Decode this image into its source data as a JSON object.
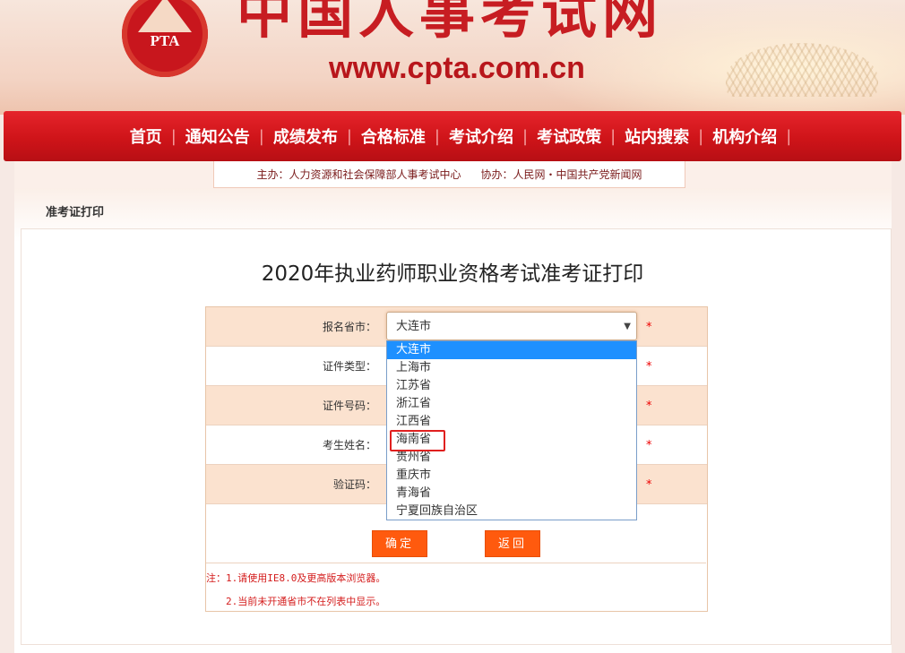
{
  "header": {
    "logo_text": "PTA",
    "site_title": "中国人事考试网",
    "site_url": "www.cpta.com.cn"
  },
  "nav": [
    {
      "label": "首页"
    },
    {
      "label": "通知公告"
    },
    {
      "label": "成绩发布"
    },
    {
      "label": "合格标准"
    },
    {
      "label": "考试介绍"
    },
    {
      "label": "考试政策"
    },
    {
      "label": "站内搜索"
    },
    {
      "label": "机构介绍"
    }
  ],
  "nav_separator": "|",
  "sponsor": {
    "host": "主办：人力资源和社会保障部人事考试中心",
    "cohost": "协办：人民网・中国共产党新闻网"
  },
  "breadcrumb": "准考证打印",
  "page_title": "2020年执业药师职业资格考试准考证打印",
  "form": {
    "rows": [
      {
        "label": "报名省市："
      },
      {
        "label": "证件类型："
      },
      {
        "label": "证件号码："
      },
      {
        "label": "考生姓名："
      },
      {
        "label": "验证码："
      }
    ],
    "required_mark": "*",
    "province_select": {
      "value": "大连市",
      "arrow": "▼",
      "options": [
        "大连市",
        "上海市",
        "江苏省",
        "浙江省",
        "江西省",
        "海南省",
        "贵州省",
        "重庆市",
        "青海省",
        "宁夏回族自治区"
      ]
    },
    "confirm_label": "确定",
    "back_label": "返回"
  },
  "notes": {
    "line1": "注：1.请使用IE8.0及更高版本浏览器。",
    "line2": "2.当前未开通省市不在列表中显示。"
  },
  "colors": {
    "brand_red": "#c8161d",
    "button_orange": "#ff5a0e",
    "row_shade": "#fbe2cf",
    "select_highlight": "#1e90ff",
    "annotation_red": "#e0201f"
  }
}
